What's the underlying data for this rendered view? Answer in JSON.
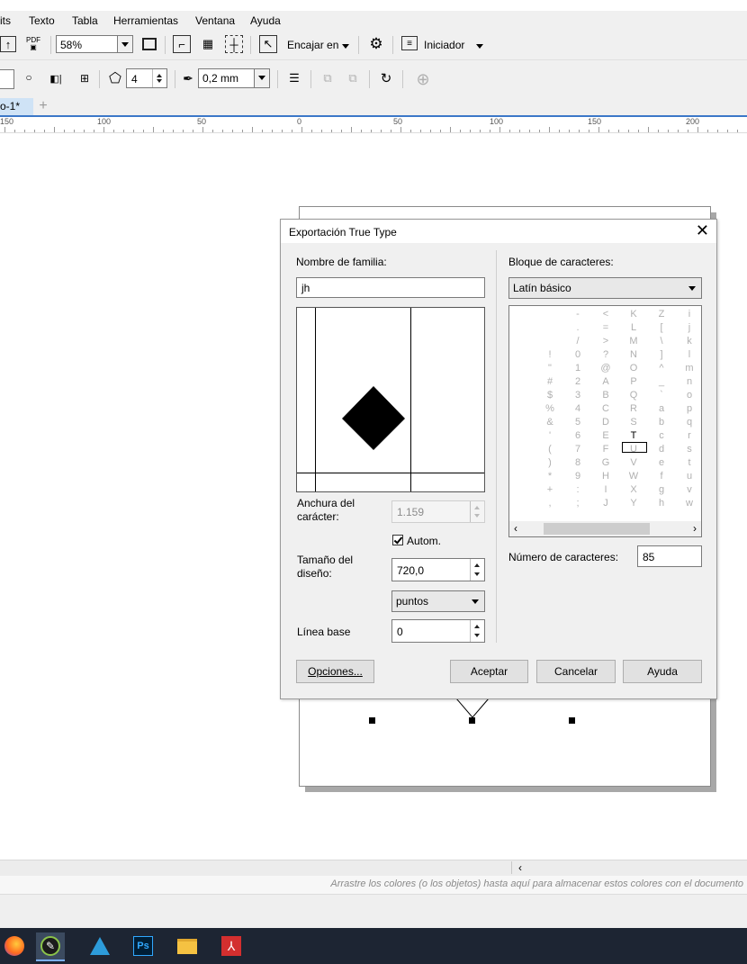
{
  "menu": [
    "its",
    "Texto",
    "Tabla",
    "Herramientas",
    "Ventana",
    "Ayuda"
  ],
  "toolbar1": {
    "pdf_label": "PDF",
    "zoom_value": "58%",
    "fit_label": "Encajar en",
    "launcher_label": "Iniciador"
  },
  "toolbar2": {
    "polygon_sides": "4",
    "outline_width": "0,2 mm"
  },
  "tab": {
    "document_label": "o-1*"
  },
  "ruler": [
    "150",
    "100",
    "50",
    "0",
    "50",
    "100",
    "150",
    "200"
  ],
  "dialog": {
    "title": "Exportación True Type",
    "family_label": "Nombre de familia:",
    "family_value": "jh",
    "char_width_label_1": "Anchura del",
    "char_width_label_2": "carácter:",
    "char_width_value": "1.159",
    "autom_label": "Autom.",
    "design_size_label_1": "Tamaño del",
    "design_size_label_2": "diseño:",
    "design_size_value": "720,0",
    "units_value": "puntos",
    "baseline_label": "Línea base",
    "baseline_value": "0",
    "block_label": "Bloque de caracteres:",
    "block_value": "Latín básico",
    "num_chars_label": "Número de caracteres:",
    "num_chars_value": "85",
    "options_button": "Opciones...",
    "ok_button": "Aceptar",
    "cancel_button": "Cancelar",
    "help_button": "Ayuda",
    "char_columns": [
      [
        "",
        "",
        "",
        "",
        "",
        "",
        "",
        "",
        "",
        "",
        "",
        "",
        "",
        "",
        ""
      ],
      [
        "",
        "",
        "",
        "!",
        "\"",
        "#",
        "$",
        "%",
        "&",
        "'",
        "(",
        ")",
        "*",
        "+",
        ","
      ],
      [
        "-",
        ".",
        "/",
        "0",
        "1",
        "2",
        "3",
        "4",
        "5",
        "6",
        "7",
        "8",
        "9",
        ":",
        ";"
      ],
      [
        "<",
        "=",
        ">",
        "?",
        "@",
        "A",
        "B",
        "C",
        "D",
        "E",
        "F",
        "G",
        "H",
        "I",
        "J"
      ],
      [
        "K",
        "L",
        "M",
        "N",
        "O",
        "P",
        "Q",
        "R",
        "S",
        "T",
        "U",
        "V",
        "W",
        "X",
        "Y"
      ],
      [
        "Z",
        "[",
        "\\",
        "]",
        "^",
        "_",
        "`",
        "a",
        "b",
        "c",
        "d",
        "e",
        "f",
        "g",
        "h"
      ],
      [
        "i",
        "j",
        "k",
        "l",
        "m",
        "n",
        "o",
        "p",
        "q",
        "r",
        "s",
        "t",
        "u",
        "v",
        "w"
      ]
    ]
  },
  "status": {
    "palette_hint": "Arrastre los colores (o los objetos) hasta aquí para almacenar estos colores con el documento"
  }
}
